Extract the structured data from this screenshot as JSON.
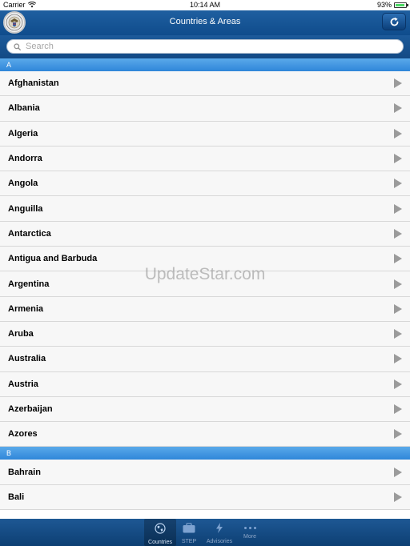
{
  "status_bar": {
    "carrier": "Carrier",
    "time": "10:14 AM",
    "battery": "93%",
    "battery_level": 0.93
  },
  "nav": {
    "title": "Countries & Areas"
  },
  "search": {
    "placeholder": "Search"
  },
  "sections": [
    {
      "header": "A",
      "items": [
        "Afghanistan",
        "Albania",
        "Algeria",
        "Andorra",
        "Angola",
        "Anguilla",
        "Antarctica",
        "Antigua and Barbuda",
        "Argentina",
        "Armenia",
        "Aruba",
        "Australia",
        "Austria",
        "Azerbaijan",
        "Azores"
      ]
    },
    {
      "header": "B",
      "items": [
        "Bahrain",
        "Bali"
      ]
    }
  ],
  "watermark": "UpdateStar.com",
  "tabs": [
    {
      "label": "Countries",
      "icon": "globe-icon",
      "active": true
    },
    {
      "label": "STEP",
      "icon": "briefcase-icon",
      "active": false
    },
    {
      "label": "Advisories",
      "icon": "lightning-icon",
      "active": false
    },
    {
      "label": "More",
      "icon": "more-dots-icon",
      "active": false
    }
  ],
  "colors": {
    "nav_blue": "#0f4c8c",
    "section_blue": "#3a8fde",
    "row_bg": "#f7f7f7",
    "arrow_gray": "#9b9b9b"
  }
}
